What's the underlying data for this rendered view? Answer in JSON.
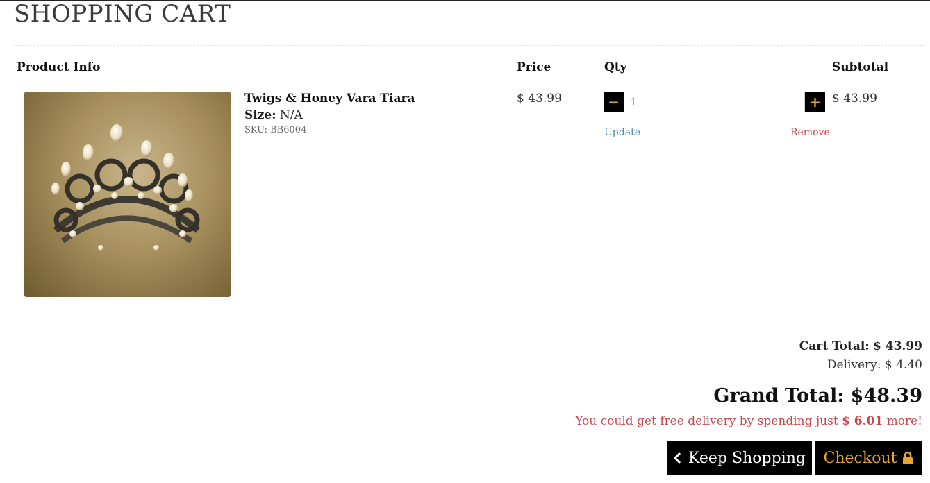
{
  "page": {
    "title": "SHOPPING CART"
  },
  "columns": {
    "product": "Product Info",
    "price": "Price",
    "qty": "Qty",
    "subtotal": "Subtotal"
  },
  "item": {
    "name": "Twigs & Honey Vara Tiara",
    "size_label": "Size:",
    "size_value": "N/A",
    "sku": "SKU: BB6004",
    "price": "$ 43.99",
    "quantity": "1",
    "subtotal": "$ 43.99",
    "update_label": "Update",
    "remove_label": "Remove",
    "image_icon": "tiara-photo"
  },
  "totals": {
    "cart_total_label": "Cart Total:",
    "cart_total_value": "$ 43.99",
    "delivery": "Delivery: $ 4.40",
    "grand_total": "Grand Total: $48.39",
    "free_delivery_pre": "You could get free delivery by spending just",
    "free_delivery_amount": "$ 6.01",
    "free_delivery_post": "more!"
  },
  "buttons": {
    "keep_shopping": "Keep Shopping",
    "checkout": "Checkout",
    "keep_icon": "chevron-left-icon",
    "checkout_icon": "lock-icon"
  },
  "colors": {
    "accent": "#e9a52d",
    "link": "#4e8ca8",
    "alert": "#c9484c",
    "button_bg": "#000000"
  }
}
